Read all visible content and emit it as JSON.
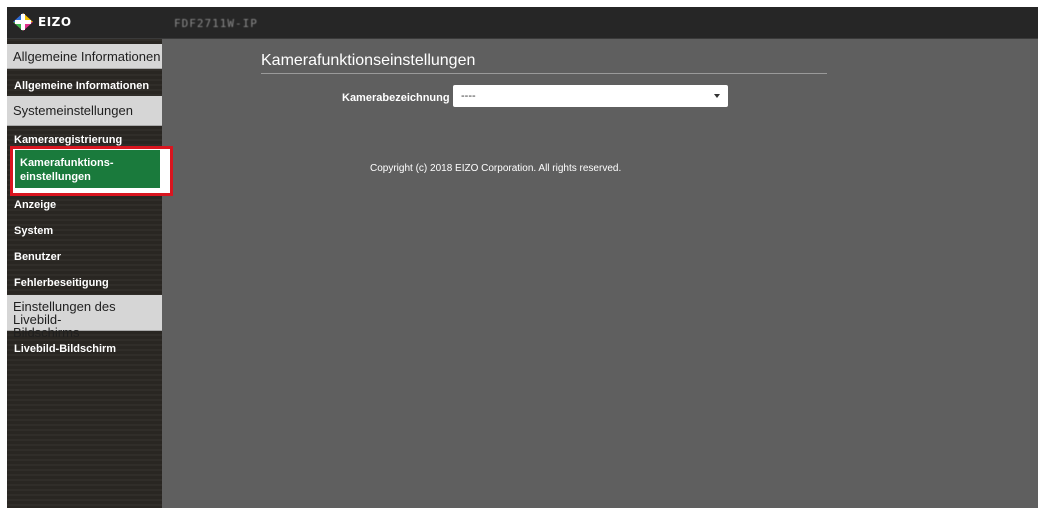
{
  "header": {
    "logo_text": "EIZO",
    "device_name": "FDF2711W-IP"
  },
  "sidebar": {
    "sections": [
      {
        "title": "Allgemeine Informationen",
        "items": [
          {
            "label": "Allgemeine Informationen"
          }
        ]
      },
      {
        "title": "Systemeinstellungen",
        "items": [
          {
            "label": "Kameraregistrierung"
          },
          {
            "label": "Kamerafunktions-\neinstellungen",
            "active": true
          },
          {
            "label": "Anzeige"
          },
          {
            "label": "System"
          },
          {
            "label": "Benutzer"
          },
          {
            "label": "Fehlerbeseitigung"
          }
        ]
      },
      {
        "title": "Einstellungen des Livebild-\nBildschirms",
        "items": [
          {
            "label": "Livebild-Bildschirm"
          }
        ]
      }
    ]
  },
  "main": {
    "title": "Kamerafunktionseinstellungen",
    "field_label": "Kamerabezeichnung",
    "select_value": "----",
    "copyright": "Copyright (c) 2018 EIZO Corporation. All rights reserved."
  },
  "colors": {
    "active_item": "#1a7a3c",
    "highlight_border": "#d9151f",
    "topbar": "#262626",
    "content_bg": "#5f5f5f"
  }
}
